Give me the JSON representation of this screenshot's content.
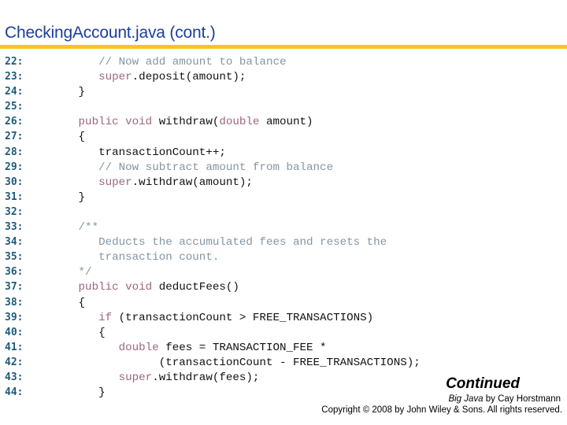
{
  "title": "CheckingAccount.java  (cont.)",
  "colors": {
    "title": "#1c3f9a",
    "rule": "#f3c623",
    "line_number": "#1f5a7a",
    "keyword": "#9a6780",
    "comment": "#8495a3",
    "code": "#111111"
  },
  "code_lines": [
    {
      "num": "22:",
      "tokens": [
        {
          "t": "      ",
          "c": ""
        },
        {
          "t": "// Now add amount to balance",
          "c": "cm"
        }
      ]
    },
    {
      "num": "23:",
      "tokens": [
        {
          "t": "      ",
          "c": ""
        },
        {
          "t": "super",
          "c": "kw"
        },
        {
          "t": ".deposit(amount);",
          "c": ""
        }
      ]
    },
    {
      "num": "24:",
      "tokens": [
        {
          "t": "   }",
          "c": ""
        }
      ]
    },
    {
      "num": "25:",
      "tokens": []
    },
    {
      "num": "26:",
      "tokens": [
        {
          "t": "   ",
          "c": ""
        },
        {
          "t": "public void",
          "c": "kw"
        },
        {
          "t": " withdraw(",
          "c": ""
        },
        {
          "t": "double",
          "c": "kw"
        },
        {
          "t": " amount)",
          "c": ""
        }
      ]
    },
    {
      "num": "27:",
      "tokens": [
        {
          "t": "   {",
          "c": ""
        }
      ]
    },
    {
      "num": "28:",
      "tokens": [
        {
          "t": "      transactionCount++;",
          "c": ""
        }
      ]
    },
    {
      "num": "29:",
      "tokens": [
        {
          "t": "      ",
          "c": ""
        },
        {
          "t": "// Now subtract amount from balance",
          "c": "cm"
        }
      ]
    },
    {
      "num": "30:",
      "tokens": [
        {
          "t": "      ",
          "c": ""
        },
        {
          "t": "super",
          "c": "kw"
        },
        {
          "t": ".withdraw(amount);",
          "c": ""
        }
      ]
    },
    {
      "num": "31:",
      "tokens": [
        {
          "t": "   }",
          "c": ""
        }
      ]
    },
    {
      "num": "32:",
      "tokens": []
    },
    {
      "num": "33:",
      "tokens": [
        {
          "t": "   ",
          "c": ""
        },
        {
          "t": "/**",
          "c": "cm"
        }
      ]
    },
    {
      "num": "34:",
      "tokens": [
        {
          "t": "      ",
          "c": ""
        },
        {
          "t": "Deducts the accumulated fees and resets the",
          "c": "cm"
        }
      ]
    },
    {
      "num": "35:",
      "tokens": [
        {
          "t": "      ",
          "c": ""
        },
        {
          "t": "transaction count.",
          "c": "cm"
        }
      ]
    },
    {
      "num": "36:",
      "tokens": [
        {
          "t": "   ",
          "c": ""
        },
        {
          "t": "*/",
          "c": "cm"
        }
      ]
    },
    {
      "num": "37:",
      "tokens": [
        {
          "t": "   ",
          "c": ""
        },
        {
          "t": "public void",
          "c": "kw"
        },
        {
          "t": " deductFees()",
          "c": ""
        }
      ]
    },
    {
      "num": "38:",
      "tokens": [
        {
          "t": "   {",
          "c": ""
        }
      ]
    },
    {
      "num": "39:",
      "tokens": [
        {
          "t": "      ",
          "c": ""
        },
        {
          "t": "if",
          "c": "kw"
        },
        {
          "t": " (transactionCount > FREE_TRANSACTIONS)",
          "c": ""
        }
      ]
    },
    {
      "num": "40:",
      "tokens": [
        {
          "t": "      {",
          "c": ""
        }
      ]
    },
    {
      "num": "41:",
      "tokens": [
        {
          "t": "         ",
          "c": ""
        },
        {
          "t": "double",
          "c": "kw"
        },
        {
          "t": " fees = TRANSACTION_FEE *",
          "c": ""
        }
      ]
    },
    {
      "num": "42:",
      "tokens": [
        {
          "t": "               (transactionCount - FREE_TRANSACTIONS);",
          "c": ""
        }
      ]
    },
    {
      "num": "43:",
      "tokens": [
        {
          "t": "         ",
          "c": ""
        },
        {
          "t": "super",
          "c": "kw"
        },
        {
          "t": ".withdraw(fees);",
          "c": ""
        }
      ]
    },
    {
      "num": "44:",
      "tokens": [
        {
          "t": "      }",
          "c": ""
        }
      ]
    }
  ],
  "footer": {
    "continued": "Continued",
    "book_title": "Big Java",
    "book_author": " by Cay Horstmann",
    "copyright": "Copyright © 2008 by John Wiley & Sons.  All rights reserved."
  }
}
